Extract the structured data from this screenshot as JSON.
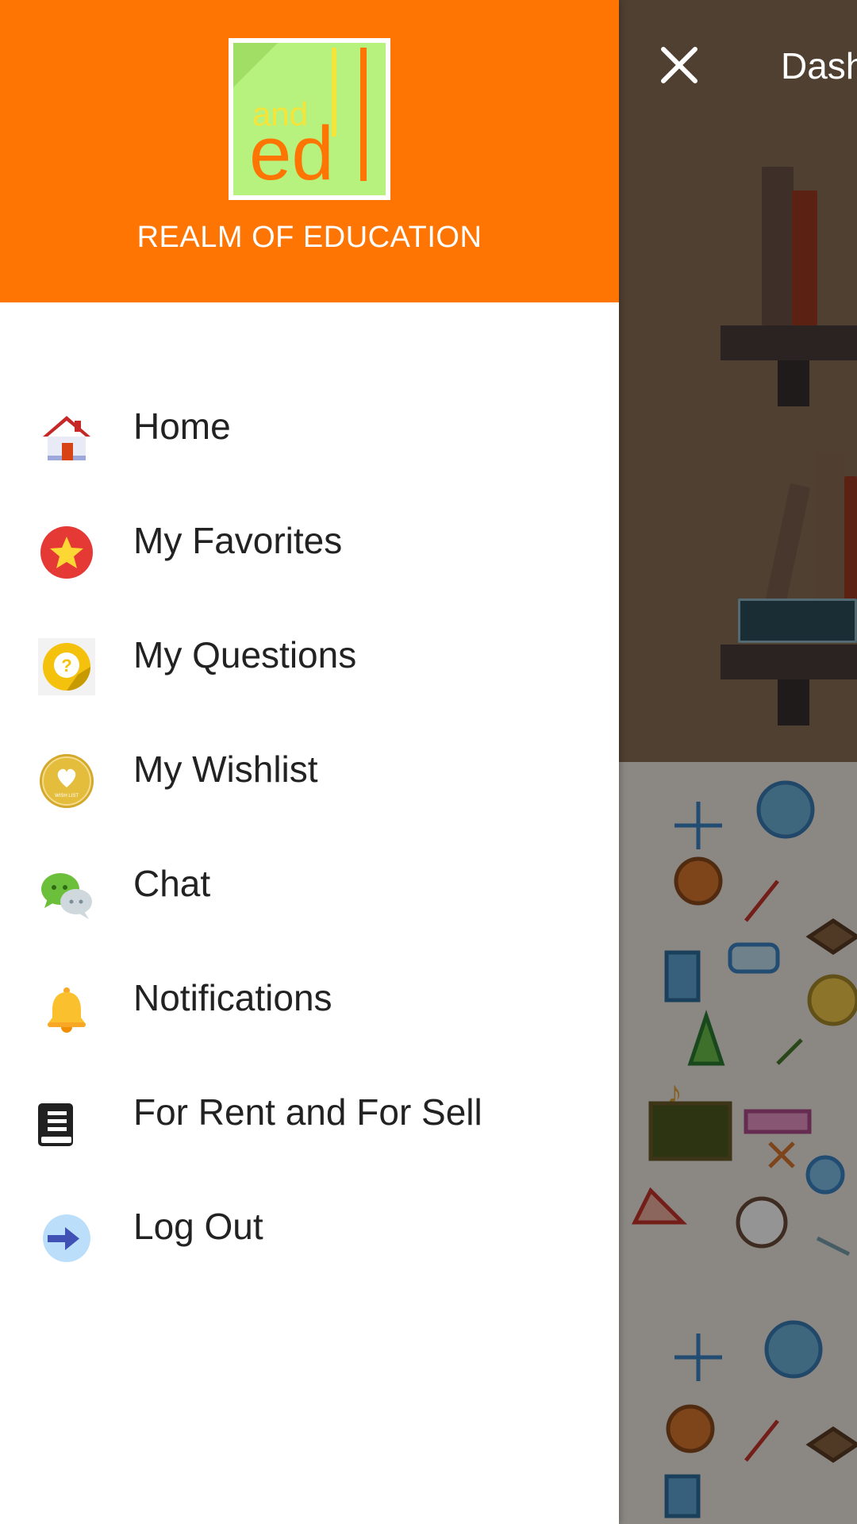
{
  "header": {
    "close_icon": "close-icon",
    "title": "Dash"
  },
  "drawer": {
    "brand": "REALM OF EDUCATION",
    "logo_text_top": "and",
    "logo_text_main": "ed",
    "logo_text_accent": "l",
    "accent_color": "#ff7504",
    "items": [
      {
        "label": "Home",
        "icon": "home-icon"
      },
      {
        "label": "My Favorites",
        "icon": "star-icon"
      },
      {
        "label": "My Questions",
        "icon": "question-icon"
      },
      {
        "label": "My Wishlist",
        "icon": "heart-icon"
      },
      {
        "label": "Chat",
        "icon": "chat-icon"
      },
      {
        "label": "Notifications",
        "icon": "bell-icon"
      },
      {
        "label": "For Rent and For Sell",
        "icon": "book-icon"
      },
      {
        "label": "Log Out",
        "icon": "logout-icon"
      }
    ],
    "wishlist_badge_text": "WISH LIST"
  }
}
